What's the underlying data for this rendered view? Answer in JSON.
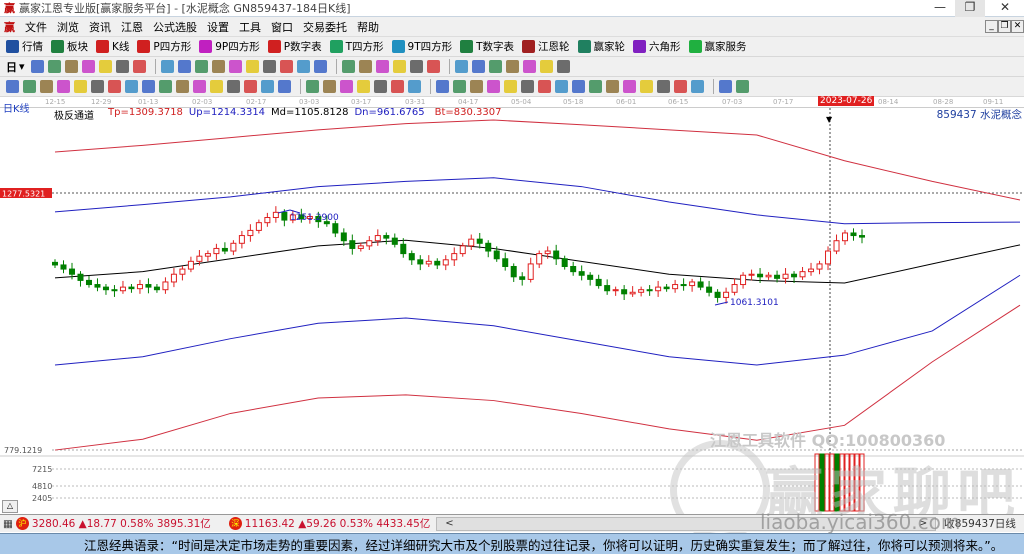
{
  "window": {
    "title": "赢家江恩专业版[赢家服务平台] - [水泥概念  GN859437-184日K线]",
    "minimize": "—",
    "restore": "❐",
    "close": "✕"
  },
  "menu": [
    "文件",
    "浏览",
    "资讯",
    "江恩",
    "公式选股",
    "设置",
    "工具",
    "窗口",
    "交易委托",
    "帮助"
  ],
  "toolbar1": [
    {
      "label": "行情",
      "icon": "grid-icon",
      "color": "#2050a0"
    },
    {
      "label": "板块",
      "icon": "blocks-icon",
      "color": "#208040"
    },
    {
      "label": "K线",
      "icon": "kline-icon",
      "color": "#d02020"
    },
    {
      "label": "P四方形",
      "icon": "p-square-icon",
      "color": "#d02020"
    },
    {
      "label": "9P四方形",
      "icon": "9p-square-icon",
      "color": "#c020c0"
    },
    {
      "label": "P数字表",
      "icon": "p-table-icon",
      "color": "#d02020"
    },
    {
      "label": "T四方形",
      "icon": "t-square-icon",
      "color": "#20a060"
    },
    {
      "label": "9T四方形",
      "icon": "9t-square-icon",
      "color": "#2090c0"
    },
    {
      "label": "T数字表",
      "icon": "t-table-icon",
      "color": "#208040"
    },
    {
      "label": "江恩轮",
      "icon": "gann-wheel-icon",
      "color": "#a02020"
    },
    {
      "label": "赢家轮",
      "icon": "winner-wheel-icon",
      "color": "#208060"
    },
    {
      "label": "六角形",
      "icon": "hexagon-icon",
      "color": "#8020c0"
    },
    {
      "label": "赢家服务",
      "icon": "dollar-icon",
      "color": "#20b040"
    }
  ],
  "period_selector": "日",
  "chart_label": "日K线",
  "indicator": {
    "name": "极反通道",
    "tp": "Tp=1309.3718",
    "up": "Up=1214.3314",
    "md": "Md=1105.8128",
    "dn": "Dn=961.6765",
    "bt": "Bt=830.3307"
  },
  "symbol_label": "859437 水泥概念",
  "watermark": {
    "qq": "江恩工具软件  QQ:100800360",
    "logo": "赢家聊吧",
    "url": "liaoba.yicai360.com"
  },
  "status": {
    "sh": "3280.46 ▲18.77 0.58% 3895.31亿",
    "sz": "11163.42 ▲59.26 0.53% 4433.45亿",
    "sh_icon": "沪",
    "sz_icon": "深",
    "right": "收859437日线"
  },
  "quote": "江恩经典语录：“时间是决定市场走势的重要因素，经过详细研究大市及个别股票的过往记录，你将可以证明，历史确实重复发生；而了解过往，你将可以预测将来。”。",
  "colors": {
    "up": "#e02020",
    "down": "#008000",
    "band_outer": "#d03040",
    "band_inner": "#2020c0",
    "mid": "#000000"
  },
  "chart_data": {
    "type": "candlestick",
    "x_ticks": [
      "12-15",
      "12-29",
      "01-13",
      "02-03",
      "02-17",
      "03-03",
      "03-17",
      "03-31",
      "04-17",
      "05-04",
      "05-18",
      "06-01",
      "06-15",
      "07-03",
      "07-17",
      "2023-07-26",
      "08-14",
      "08-28",
      "09-11"
    ],
    "cursor_date": "2023-07-26",
    "y_labels": {
      "cursor_price": "1277.5321",
      "low_price": "779.1219"
    },
    "ylim": [
      779.12,
      1277.53
    ],
    "annotations": [
      {
        "text": "1251.2900",
        "type": "high"
      },
      {
        "text": "1061.3101",
        "type": "low"
      }
    ],
    "closes": [
      1138,
      1130,
      1120,
      1108,
      1100,
      1095,
      1090,
      1088,
      1095,
      1092,
      1100,
      1095,
      1090,
      1105,
      1120,
      1130,
      1145,
      1155,
      1160,
      1170,
      1165,
      1180,
      1195,
      1205,
      1220,
      1230,
      1240,
      1225,
      1235,
      1228,
      1232,
      1222,
      1218,
      1200,
      1185,
      1170,
      1175,
      1185,
      1195,
      1190,
      1178,
      1160,
      1148,
      1140,
      1145,
      1138,
      1148,
      1160,
      1175,
      1188,
      1180,
      1165,
      1150,
      1135,
      1115,
      1110,
      1140,
      1160,
      1165,
      1150,
      1135,
      1125,
      1118,
      1110,
      1098,
      1088,
      1090,
      1082,
      1085,
      1090,
      1088,
      1095,
      1092,
      1100,
      1098,
      1105,
      1095,
      1085,
      1075,
      1085,
      1100,
      1118,
      1120,
      1115,
      1118,
      1112,
      1120,
      1115,
      1125,
      1130,
      1140,
      1165,
      1185,
      1200,
      1195,
      1192
    ],
    "bands": {
      "top": [
        1357,
        1370,
        1385,
        1400,
        1412,
        1419,
        1410,
        1400,
        1390,
        1340,
        1300,
        1264
      ],
      "upper": [
        1241,
        1255,
        1270,
        1290,
        1300,
        1307,
        1290,
        1260,
        1235,
        1218,
        1220,
        1221
      ],
      "middle": [
        1113,
        1125,
        1150,
        1175,
        1186,
        1170,
        1145,
        1120,
        1108,
        1103,
        1140,
        1177
      ],
      "lower": [
        944,
        960,
        995,
        1025,
        1035,
        1020,
        990,
        960,
        944,
        963,
        1010,
        1118
      ],
      "bottom": [
        779,
        800,
        850,
        880,
        886,
        875,
        850,
        820,
        798,
        827,
        950,
        1060
      ]
    },
    "volume": {
      "y_ticks": [
        "7215",
        "4810",
        "2405"
      ],
      "bars": [
        {
          "v": 9000,
          "up": true
        },
        {
          "v": 9000,
          "up": false
        },
        {
          "v": 9000,
          "up": true
        },
        {
          "v": 9000,
          "up": true
        },
        {
          "v": 9000,
          "up": false
        },
        {
          "v": 9000,
          "up": true
        },
        {
          "v": 9000,
          "up": true
        },
        {
          "v": 9000,
          "up": true
        },
        {
          "v": 9000,
          "up": true
        },
        {
          "v": 9000,
          "up": true
        }
      ]
    }
  }
}
